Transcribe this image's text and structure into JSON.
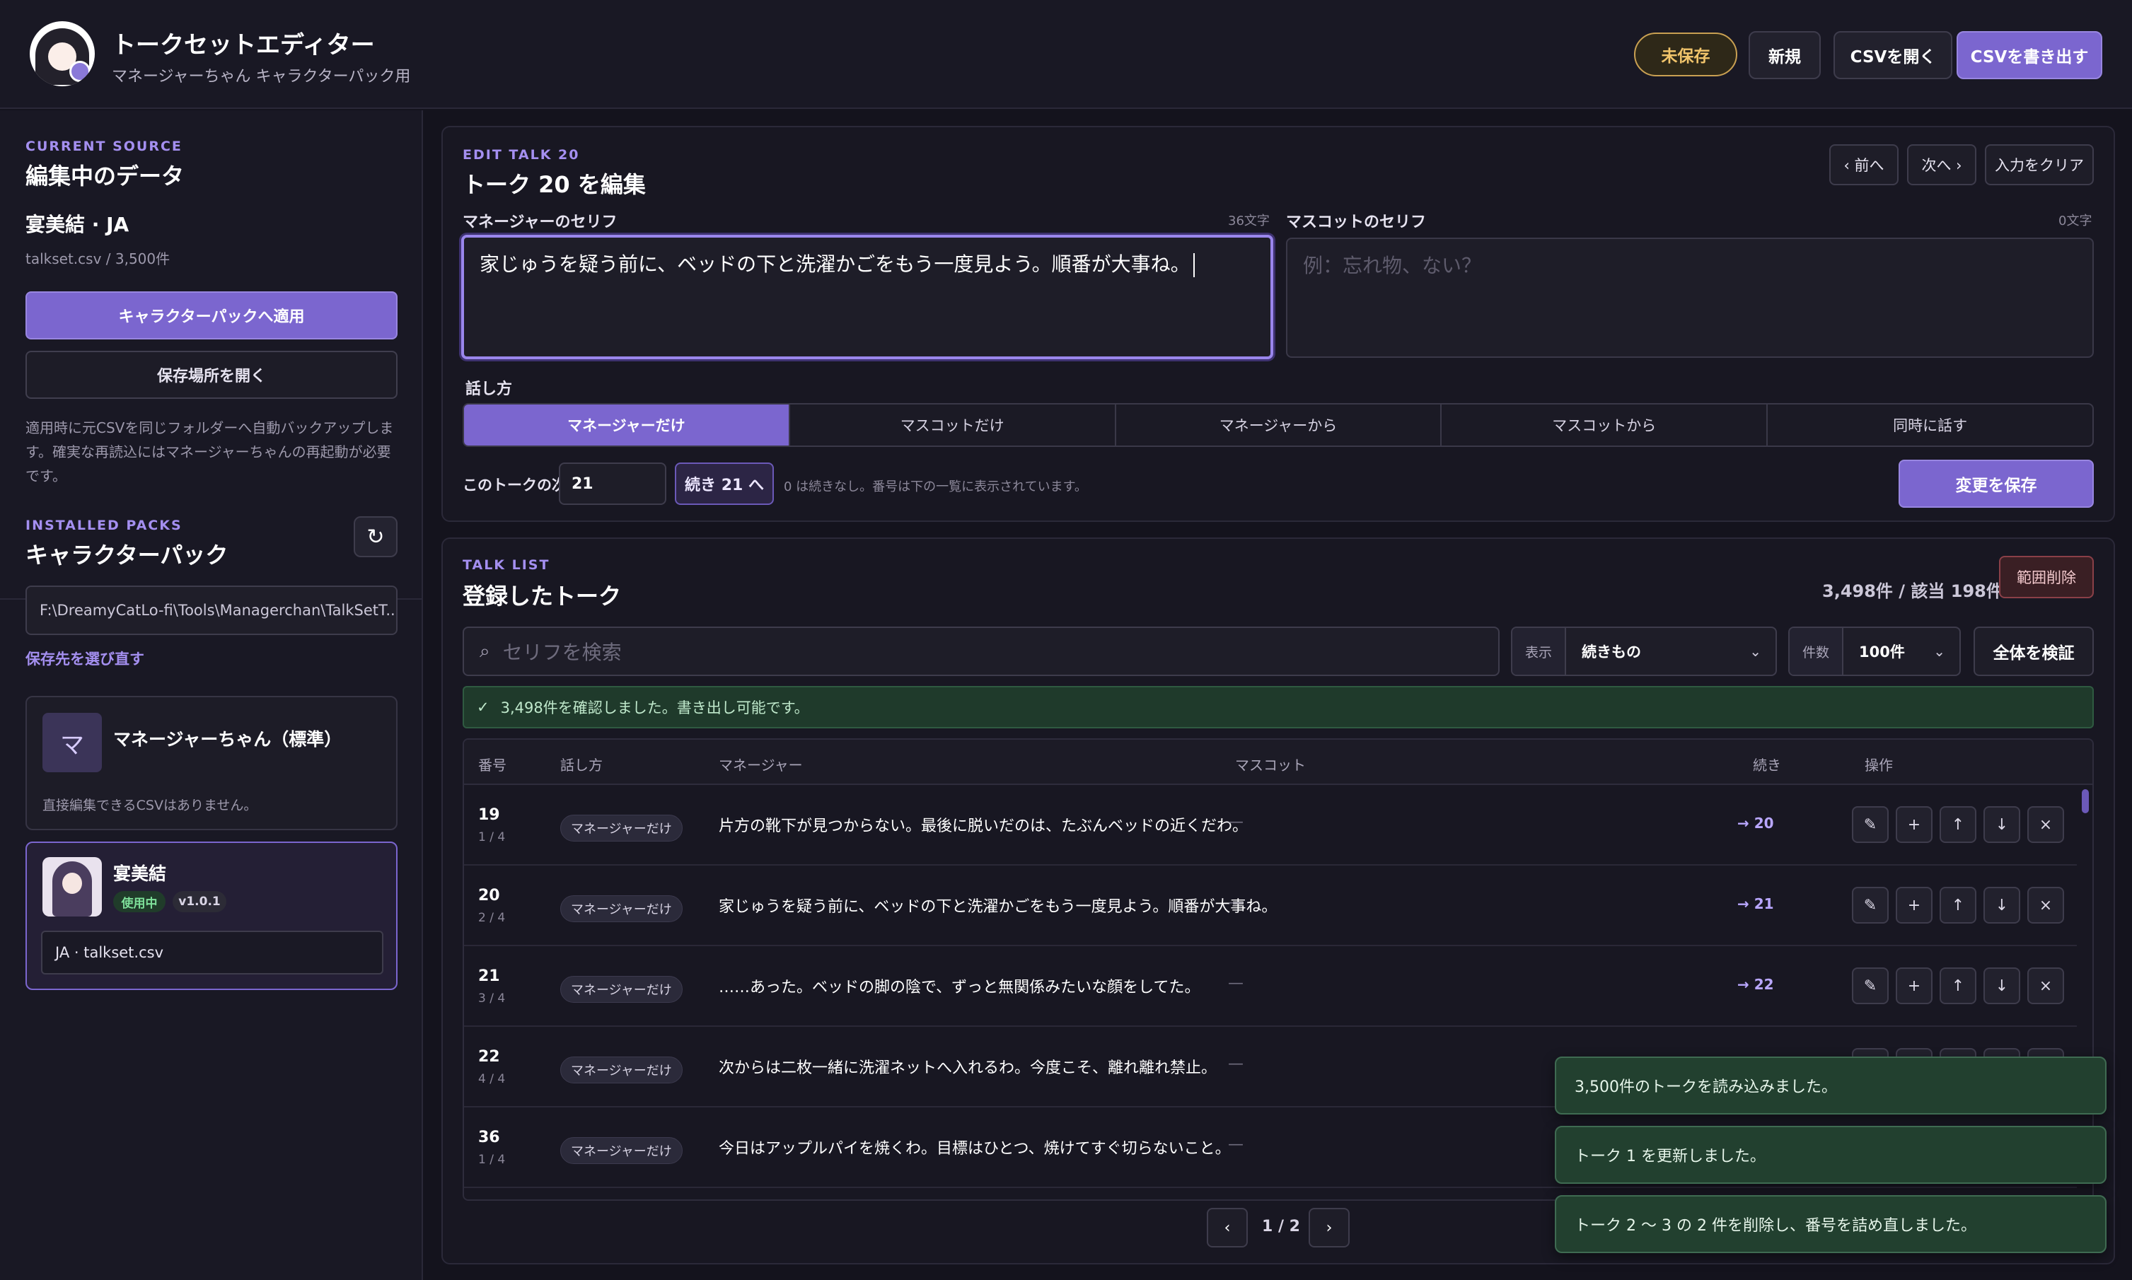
{
  "header": {
    "title": "トークセットエディター",
    "subtitle": "マネージャーちゃん キャラクターパック用",
    "unsaved_badge": "未保存",
    "new_label": "新規",
    "open_csv_label": "CSVを開く",
    "export_csv_label": "CSVを書き出す"
  },
  "sidebar": {
    "source": {
      "eyebrow": "CURRENT SOURCE",
      "title": "編集中のデータ",
      "name": "宴美結 · JA",
      "meta": "talkset.csv / 3,500件",
      "apply_label": "キャラクターパックへ適用",
      "open_location_label": "保存場所を開く",
      "note": "適用時に元CSVを同じフォルダーへ自動バックアップします。確実な再読込にはマネージャーちゃんの再起動が必要です。"
    },
    "packs": {
      "eyebrow": "INSTALLED PACKS",
      "title": "キャラクターパック",
      "refresh_icon": "↻",
      "path": "F:\\DreamyCatLo-fi\\Tools\\Managerchan\\TalkSetT...",
      "rechoose_label": "保存先を選び直す",
      "items": [
        {
          "icon": "マ",
          "name": "マネージャーちゃん（標準）",
          "note": "直接編集できるCSVはありません。"
        },
        {
          "name": "宴美結",
          "status": "使用中",
          "version": "v1.0.1",
          "file": "JA · talkset.csv"
        }
      ]
    }
  },
  "editor": {
    "eyebrow": "EDIT TALK 20",
    "title": "トーク 20 を編集",
    "prev_label": "‹ 前へ",
    "next_label": "次へ ›",
    "clear_label": "入力をクリア",
    "manager_label": "マネージャーのセリフ",
    "manager_count": "36文字",
    "manager_text": "家じゅうを疑う前に、ベッドの下と洗濯かごをもう一度見よう。順番が大事ね。",
    "mascot_label": "マスコットのセリフ",
    "mascot_count": "0文字",
    "mascot_placeholder": "例：忘れ物、ない？",
    "style_label": "話し方",
    "styles": [
      "マネージャーだけ",
      "マスコットだけ",
      "マネージャーから",
      "マスコットから",
      "同時に話す"
    ],
    "selected_style": "マネージャーだけ",
    "next_talk_label": "このトークの次",
    "next_talk_value": "21",
    "continue_button": "続き 21 へ",
    "next_hint": "0 は続きなし。番号は下の一覧に表示されています。",
    "save_label": "変更を保存"
  },
  "list": {
    "eyebrow": "TALK LIST",
    "title": "登録したトーク",
    "summary": "3,498件 / 該当 198件",
    "range_delete_label": "範囲削除",
    "search_placeholder": "セリフを検索",
    "search_icon": "⌕",
    "display_label": "表示",
    "display_value": "続きもの",
    "count_label": "件数",
    "count_value": "100件",
    "validate_label": "全体を検証",
    "status_text": "3,498件を確認しました。書き出し可能です。",
    "columns": [
      "番号",
      "話し方",
      "マネージャー",
      "マスコット",
      "続き",
      "操作"
    ],
    "rows": [
      {
        "num": "19",
        "pos": "1 / 4",
        "style": "マネージャーだけ",
        "manager": "片方の靴下が見つからない。最後に脱いだのは、たぶんベッドの近くだわ。",
        "mascot": "—",
        "next": "→ 20"
      },
      {
        "num": "20",
        "pos": "2 / 4",
        "style": "マネージャーだけ",
        "manager": "家じゅうを疑う前に、ベッドの下と洗濯かごをもう一度見よう。順番が大事ね。",
        "mascot": "—",
        "next": "→ 21"
      },
      {
        "num": "21",
        "pos": "3 / 4",
        "style": "マネージャーだけ",
        "manager": "……あった。ベッドの脚の陰で、ずっと無関係みたいな顔をしてた。",
        "mascot": "—",
        "next": "→ 22"
      },
      {
        "num": "22",
        "pos": "4 / 4",
        "style": "マネージャーだけ",
        "manager": "次からは二枚一緒に洗濯ネットへ入れるわ。今度こそ、離れ離れ禁止。",
        "mascot": "—",
        "next": ""
      },
      {
        "num": "36",
        "pos": "1 / 4",
        "style": "マネージャーだけ",
        "manager": "今日はアップルパイを焼くわ。目標はひとつ、焼けてすぐ切らないこと。",
        "mascot": "—",
        "next": ""
      }
    ],
    "row_actions": [
      "✎",
      "+",
      "↑",
      "↓",
      "×"
    ],
    "page_info": "1 / 2",
    "prev_page": "‹",
    "next_page": "›"
  },
  "toasts": [
    "3,500件のトークを読み込みました。",
    "トーク 1 を更新しました。",
    "トーク 2 〜 3 の 2 件を削除し、番号を詰め直しました。"
  ],
  "colors": {
    "accent": "#7b66cf",
    "background": "#14131d",
    "success": "#22402f",
    "warning": "#c9a052"
  }
}
